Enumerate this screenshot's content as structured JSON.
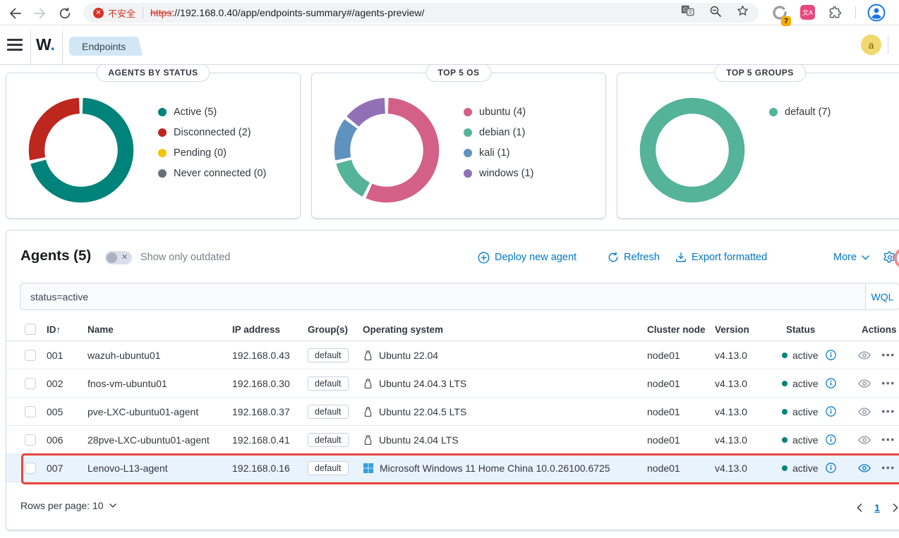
{
  "browser": {
    "security_badge": "不安全",
    "url_scheme": "https",
    "url_rest": "://192.168.0.40/app/endpoints-summary#/agents-preview/",
    "extension_badge": "7",
    "translate_ext_label": "文A",
    "icons": [
      "back-icon",
      "forward-icon",
      "reload-icon",
      "translate-page-icon",
      "zoom-out-icon",
      "bookmark-star-icon",
      "extension-icon",
      "translate-extension-icon",
      "extensions-puzzle-icon",
      "profile-icon"
    ]
  },
  "app_header": {
    "logo_w": "W",
    "logo_dot": ".",
    "breadcrumb": "Endpoints",
    "avatar": "a"
  },
  "chart_data": [
    {
      "type": "pie",
      "subtype": "donut",
      "title": "AGENTS BY STATUS",
      "categories": [
        "Active",
        "Disconnected",
        "Pending",
        "Never connected"
      ],
      "values": [
        5,
        2,
        0,
        0
      ],
      "labels": [
        "Active (5)",
        "Disconnected (2)",
        "Pending (0)",
        "Never connected (0)"
      ],
      "colors": [
        "#00837a",
        "#bd271e",
        "#f5c30e",
        "#69707d"
      ],
      "legend_position": "right"
    },
    {
      "type": "pie",
      "subtype": "donut",
      "title": "TOP 5 OS",
      "categories": [
        "ubuntu",
        "debian",
        "kali",
        "windows"
      ],
      "values": [
        4,
        1,
        1,
        1
      ],
      "labels": [
        "ubuntu (4)",
        "debian (1)",
        "kali (1)",
        "windows (1)"
      ],
      "colors": [
        "#d36086",
        "#54b399",
        "#6092c0",
        "#9170b8"
      ],
      "legend_position": "right"
    },
    {
      "type": "pie",
      "subtype": "donut",
      "title": "TOP 5 GROUPS",
      "categories": [
        "default"
      ],
      "values": [
        7
      ],
      "labels": [
        "default (7)"
      ],
      "colors": [
        "#54b399"
      ],
      "legend_position": "right"
    }
  ],
  "agents": {
    "title": "Agents (5)",
    "show_only_outdated": "Show only outdated",
    "deploy_label": "Deploy new agent",
    "refresh_label": "Refresh",
    "export_label": "Export formatted",
    "more_label": "More",
    "search_value": "status=active",
    "search_lang": "WQL",
    "table": {
      "sort_icon": "↑",
      "columns": [
        "ID",
        "Name",
        "IP address",
        "Group(s)",
        "Operating system",
        "Cluster node",
        "Version",
        "Status",
        "Actions"
      ],
      "rows": [
        {
          "id": "001",
          "name": "wazuh-ubuntu01",
          "ip": "192.168.0.43",
          "group": "default",
          "os": "Ubuntu 22.04",
          "os_icon": "linux",
          "node": "node01",
          "version": "v4.13.0",
          "status": "active",
          "highlighted": false
        },
        {
          "id": "002",
          "name": "fnos-vm-ubuntu01",
          "ip": "192.168.0.30",
          "group": "default",
          "os": "Ubuntu 24.04.3 LTS",
          "os_icon": "linux",
          "node": "node01",
          "version": "v4.13.0",
          "status": "active",
          "highlighted": false
        },
        {
          "id": "005",
          "name": "pve-LXC-ubuntu01-agent",
          "ip": "192.168.0.37",
          "group": "default",
          "os": "Ubuntu 22.04.5 LTS",
          "os_icon": "linux",
          "node": "node01",
          "version": "v4.13.0",
          "status": "active",
          "highlighted": false
        },
        {
          "id": "006",
          "name": "28pve-LXC-ubuntu01-agent",
          "ip": "192.168.0.41",
          "group": "default",
          "os": "Ubuntu 24.04 LTS",
          "os_icon": "linux",
          "node": "node01",
          "version": "v4.13.0",
          "status": "active",
          "highlighted": false
        },
        {
          "id": "007",
          "name": "Lenovo-L13-agent",
          "ip": "192.168.0.16",
          "group": "default",
          "os": "Microsoft Windows 11 Home China 10.0.26100.6725",
          "os_icon": "windows",
          "node": "node01",
          "version": "v4.13.0",
          "status": "active",
          "highlighted": true
        }
      ]
    },
    "rows_per_page": "Rows per page: 10",
    "page": "1"
  },
  "colors": {
    "accent_blue": "#0077cc",
    "active_teal": "#00837a",
    "danger_red": "#bd271e",
    "warning_yellow": "#f5c30e",
    "muted_gray": "#69707d",
    "annotation_red": "#e8453c",
    "highlight_row": "#e9f3fb",
    "chrome_red": "#d93025",
    "windows_blue": "#35a0e0"
  }
}
